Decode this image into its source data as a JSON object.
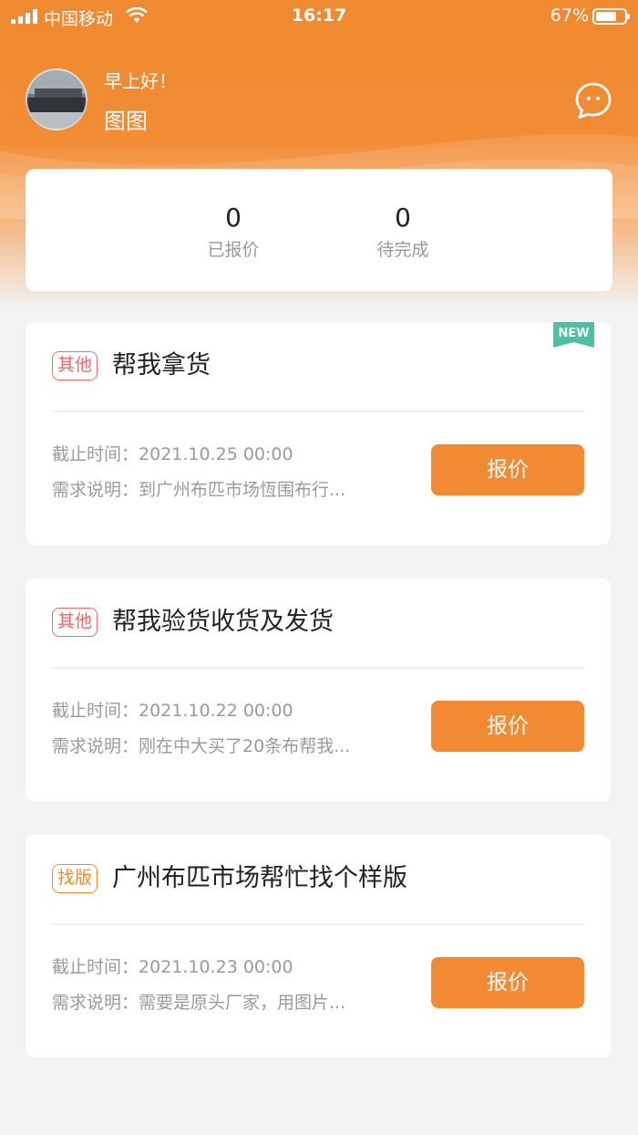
{
  "status_bar": {
    "carrier": "中国移动",
    "time": "16:17",
    "battery": "67%"
  },
  "profile": {
    "greeting": "早上好！",
    "name": "图图"
  },
  "stats": [
    {
      "value": "0",
      "label": "已报价"
    },
    {
      "value": "0",
      "label": "待完成"
    }
  ],
  "tasks": [
    {
      "tag": "其他",
      "title": "帮我拿货",
      "is_new": true,
      "new_label": "NEW",
      "deadline_label": "截止时间：",
      "deadline": "2021.10.25 00:00",
      "desc_label": "需求说明：",
      "desc": "到广州布匹市场恆围布行...",
      "button": "报价"
    },
    {
      "tag": "其他",
      "title": "帮我验货收货及发货",
      "deadline_label": "截止时间：",
      "deadline": "2021.10.22 00:00",
      "desc_label": "需求说明：",
      "desc": "刚在中大买了20条布帮我...",
      "button": "报价"
    },
    {
      "tag": "找版",
      "title": "广州布匹市场帮忙找个样版",
      "deadline_label": "截止时间：",
      "deadline": "2021.10.23 00:00",
      "desc_label": "需求说明：",
      "desc": "需要是原头厂家，用图片...",
      "button": "报价"
    }
  ],
  "colors": {
    "brand_orange": "#f28a33",
    "tag_other": "#ee6b6b",
    "tag_find": "#f08a30",
    "new_badge": "#4dbfa3"
  }
}
